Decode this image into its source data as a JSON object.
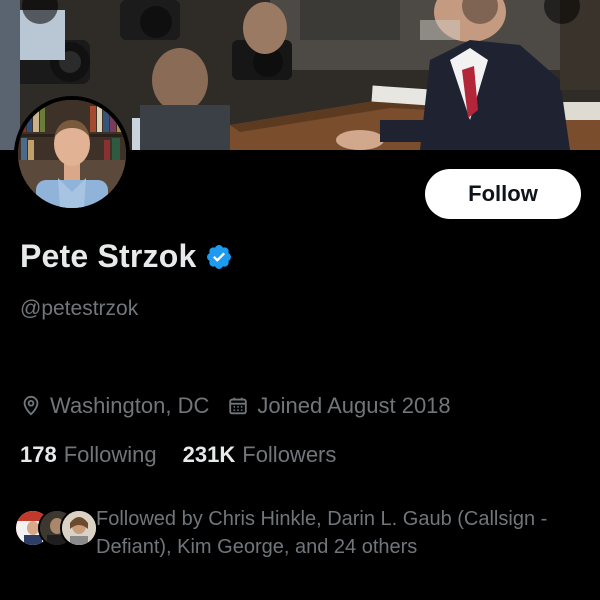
{
  "profile": {
    "display_name": "Pete Strzok",
    "handle": "@petestrzok",
    "verified": true,
    "location": "Washington, DC",
    "joined": "Joined August 2018",
    "following_count": "178",
    "following_label": "Following",
    "followers_count": "231K",
    "followers_label": "Followers"
  },
  "actions": {
    "follow_label": "Follow"
  },
  "followed_by": {
    "text": "Followed by Chris Hinkle, Darin L. Gaub (Callsign - Defiant), Kim George, and 24 others"
  },
  "colors": {
    "background": "#000000",
    "primary_text": "#e7e9ea",
    "secondary_text": "#71767b",
    "verified_badge": "#1d9bf0",
    "follow_button_bg": "#ffffff",
    "follow_button_text": "#0f1419"
  },
  "icons": {
    "verified": "verified-badge-icon",
    "location": "location-pin-icon",
    "joined": "calendar-icon"
  }
}
